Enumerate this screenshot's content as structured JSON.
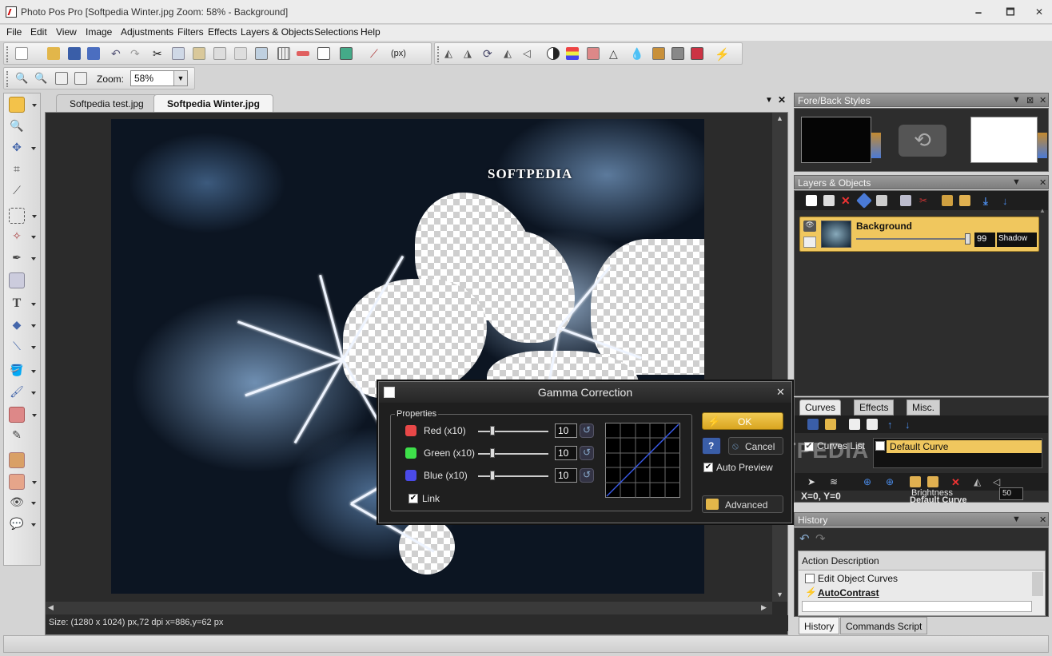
{
  "window": {
    "title": "Photo Pos Pro [Softpedia Winter.jpg Zoom: 58% - Background]",
    "min": "🗕",
    "max": "🗖",
    "close": "✕"
  },
  "menu": [
    "File",
    "Edit",
    "View",
    "Image",
    "Adjustments",
    "Filters",
    "Effects",
    "Layers & Objects",
    "Selections",
    "Help"
  ],
  "toolbar": {
    "units": "(px)",
    "zoom_label": "Zoom:",
    "zoom_value": "58%"
  },
  "tabs": [
    "Softpedia test.jpg",
    "Softpedia Winter.jpg"
  ],
  "canvas": {
    "watermark": "SOFTPEDIA"
  },
  "status": {
    "text": "Size: (1280 x 1024) px,72 dpi   x=886,y=62 px"
  },
  "panels": {
    "fore_back": {
      "title": "Fore/Back Styles",
      "fore": "#050505",
      "back": "#ffffff"
    },
    "layers": {
      "title": "Layers & Objects",
      "layer_name": "Background",
      "opacity": "99",
      "blend": "Shadow"
    },
    "curves": {
      "tabs": [
        "Curves",
        "Effects",
        "Misc."
      ],
      "list_label": "Curves List",
      "default_curve": "Default Curve",
      "coords": "X=0, Y=0",
      "brightness": "Brightness",
      "brightness_value": "50",
      "default_curve2": "Default Curve"
    },
    "history": {
      "title": "History",
      "column": "Action Description",
      "items": [
        "Edit Object Curves",
        "AutoContrast"
      ],
      "tabs": [
        "History",
        "Commands Script"
      ]
    }
  },
  "dialog": {
    "title": "Gamma Correction",
    "group": "Properties",
    "channels": [
      {
        "label": "Red (x10)",
        "value": "10",
        "color": "#e84848"
      },
      {
        "label": "Green (x10)",
        "value": "10",
        "color": "#3ee04a"
      },
      {
        "label": "Blue (x10)",
        "value": "10",
        "color": "#4a4ae8"
      }
    ],
    "link": "Link",
    "ok": "OK",
    "cancel": "Cancel",
    "help": "?",
    "auto_preview": "Auto Preview",
    "advanced": "Advanced"
  },
  "overlay_watermark": "SOFTPEDIA"
}
